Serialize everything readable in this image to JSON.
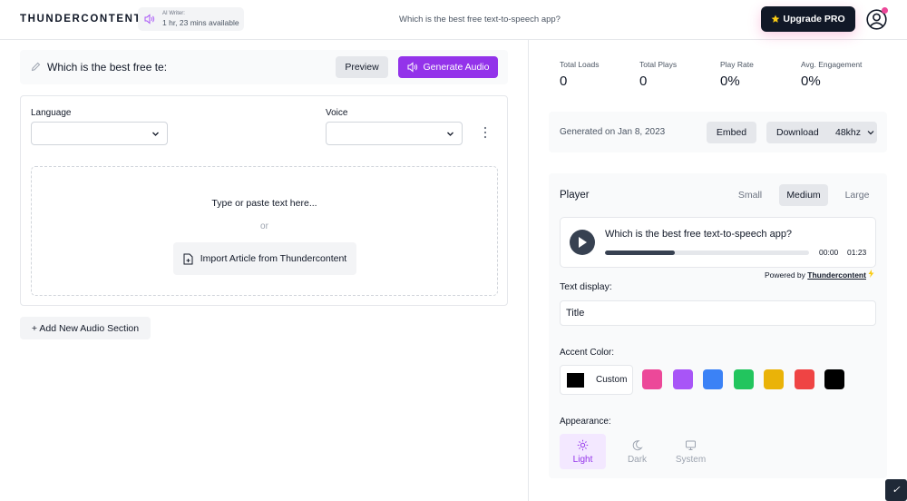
{
  "app": {
    "brand": "THUNDERCONTENT",
    "writer_label": "AI Writer:",
    "writer_time": "1 hr, 23 mins available",
    "current_question": "Which is the best free text-to-speech app?",
    "upgrade_label": "Upgrade PRO",
    "upgrade_icon": "star-icon",
    "notification_color": "#ec4899"
  },
  "editor": {
    "title_value": "Which is the best free te:",
    "preview_label": "Preview",
    "generate_label": "Generate Audio",
    "accent": "#9333ea",
    "language_label": "Language",
    "language_value": "",
    "voice_label": "Voice",
    "voice_value": "",
    "dropzone_prompt": "Type or paste text here...",
    "dropzone_or": "or",
    "import_label": "Import Article from Thundercontent",
    "add_section_label": "+ Add New Audio Section"
  },
  "stats": [
    {
      "label": "Total Loads",
      "value": "0"
    },
    {
      "label": "Total Plays",
      "value": "0"
    },
    {
      "label": "Play Rate",
      "value": "0%"
    },
    {
      "label": "Avg. Engagement",
      "value": "0%"
    }
  ],
  "generation": {
    "date_text": "Generated on Jan 8, 2023",
    "embed_label": "Embed",
    "download_label": "Download",
    "quality_value": "48khz"
  },
  "player": {
    "title": "Player",
    "sizes": [
      "Small",
      "Medium",
      "Large"
    ],
    "active_size": "Medium",
    "audio_title": "Which is the best free text-to-speech app?",
    "current_time": "00:00",
    "duration": "01:23",
    "progress_fraction": 0.34,
    "powered_prefix": "Powered by",
    "powered_brand": "Thundercontent",
    "text_display_label": "Text display:",
    "text_display_value": "Title",
    "accent_label": "Accent Color:",
    "custom_label": "Custom",
    "custom_color": "#000000",
    "accent_colors": [
      "#ec4899",
      "#a855f7",
      "#3b82f6",
      "#22c55e",
      "#eab308",
      "#ef4444",
      "#000000"
    ],
    "appearance_label": "Appearance:",
    "appearance_options": [
      {
        "label": "Light",
        "icon": "sun-icon"
      },
      {
        "label": "Dark",
        "icon": "moon-icon"
      },
      {
        "label": "System",
        "icon": "monitor-icon"
      }
    ],
    "active_appearance": "Light"
  }
}
